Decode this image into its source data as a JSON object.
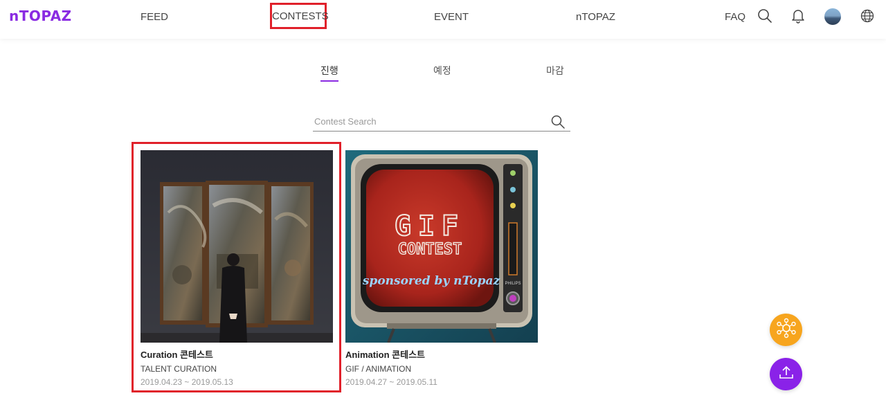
{
  "header": {
    "logo": "nTOPAZ",
    "nav": {
      "feed": "FEED",
      "contests": "CONTESTS",
      "event": "EVENT",
      "ntopaz": "nTOPAZ",
      "faq": "FAQ"
    },
    "icons": [
      "search-icon",
      "bell-icon",
      "avatar",
      "globe-icon"
    ]
  },
  "tabs": [
    {
      "label": "진행",
      "active": true
    },
    {
      "label": "예정",
      "active": false
    },
    {
      "label": "마감",
      "active": false
    }
  ],
  "search": {
    "placeholder": "Contest Search",
    "value": ""
  },
  "contests": [
    {
      "title": "Curation 콘테스트",
      "category": "TALENT CURATION",
      "dates": "2019.04.23 ~ 2019.05.13"
    },
    {
      "title": "Animation 콘테스트",
      "category": "GIF / ANIMATION",
      "dates": "2019.04.27 ~ 2019.05.11",
      "image_text": {
        "line1": "GIF",
        "line2": "CONTEST",
        "line3": "sponsored by nTopaz",
        "brand": "PHILIPS"
      }
    }
  ],
  "colors": {
    "accent": "#8a2be2",
    "highlight": "#e0202a",
    "fab_orange": "#f7a51e",
    "fab_purple": "#8a22e8"
  },
  "fabs": [
    "network-icon",
    "upload-icon"
  ]
}
